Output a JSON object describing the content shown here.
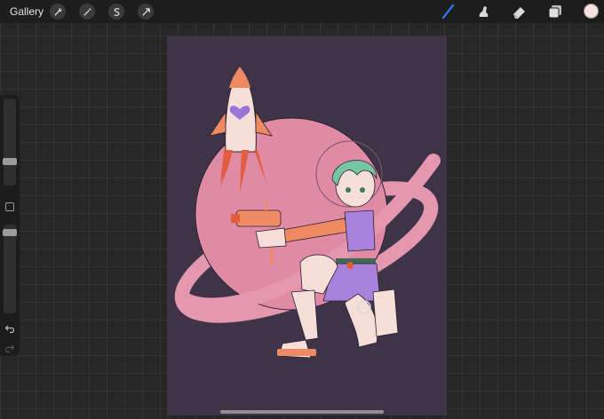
{
  "toolbar": {
    "gallery_label": "Gallery",
    "left_tools": [
      "wrench-icon",
      "magic-wand-icon",
      "selection-icon",
      "transform-arrow-icon"
    ],
    "right_tools": [
      "brush-icon",
      "smudge-icon",
      "eraser-icon",
      "layers-icon"
    ],
    "active_tool": "brush-icon",
    "active_color": "#f6e3df",
    "accent_color": "#2f7df6"
  },
  "sidebar": {
    "brush_size": 0.35,
    "opacity": 0.75
  },
  "artwork": {
    "background_color": "#3f3447",
    "planet_color": "#e08aa5",
    "ring_color": "#e597b0",
    "rocket_color": "#f7dfd9",
    "flame_color": "#e25c3e",
    "heart_color": "#9a75d9",
    "hair_color": "#76c5a3",
    "sleeve_color": "#ef8a62",
    "skirt_color": "#a982dc",
    "boot_color": "#f7dfd9"
  }
}
